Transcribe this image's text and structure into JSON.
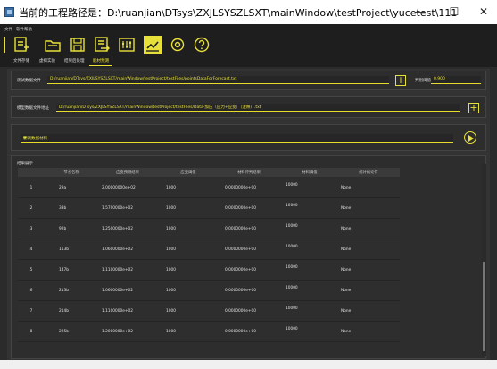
{
  "window": {
    "title": "当前的工程路径是：D:\\ruanjian\\DTsys\\ZXJLSYSZLSXT\\mainWindow\\testProject\\yucetest\\111",
    "minimize": "—",
    "maximize": "☐",
    "close": "✕"
  },
  "menu": {
    "items": [
      "文件",
      "软件帮助"
    ]
  },
  "toolbar": {
    "icons": [
      "new-file-icon",
      "open-folder-icon",
      "save-icon",
      "export-icon",
      "equalizer-icon",
      "chart-icon",
      "settings-icon",
      "help-icon"
    ]
  },
  "tabs": [
    "文件存储",
    "虚拟实验",
    "结果后处理",
    "能材预测"
  ],
  "active_tab": 3,
  "form": {
    "test_file_label": "测试数据文件",
    "test_file_value": "D:/ruanjian/DTsys/ZXJLSYSZLSXT/mainWindow/testProject/testFiles/pointsDataForForecast.txt",
    "threshold_label": "判别阈值",
    "threshold_value": "0.900",
    "model_file_label": "模型数据文件地址",
    "model_file_value": "D:/ruanjian/DTsys/ZXJLSYSZLSXT/mainWindow/testProject/testFiles/Data-加压（应力+应变）（注释）.txt",
    "test_type_value": "测试数据材料",
    "add_symbol": "+"
  },
  "results": {
    "section_label": "结果展示",
    "columns": [
      "节点名称",
      "应变预测结果",
      "应变阈值",
      "材料评判结果",
      "材料阈值",
      "统计结论符"
    ],
    "rows": [
      {
        "n": "1",
        "name": "29a",
        "strain": "2.00000000e+02",
        "strain_th": "1000",
        "mat": "0.0000000e+00",
        "mat_th": "10000",
        "concl": "None"
      },
      {
        "n": "2",
        "name": "33b",
        "strain": "1.5700000e+02",
        "strain_th": "1000",
        "mat": "0.0000000e+00",
        "mat_th": "10000",
        "concl": "None"
      },
      {
        "n": "3",
        "name": "92b",
        "strain": "1.2500000e+02",
        "strain_th": "1000",
        "mat": "0.0000000e+00",
        "mat_th": "10000",
        "concl": "None"
      },
      {
        "n": "4",
        "name": "113b",
        "strain": "1.0600000e+02",
        "strain_th": "1000",
        "mat": "0.0000000e+00",
        "mat_th": "10000",
        "concl": "None"
      },
      {
        "n": "5",
        "name": "147b",
        "strain": "1.1100000e+02",
        "strain_th": "1000",
        "mat": "0.0000000e+00",
        "mat_th": "10000",
        "concl": "None"
      },
      {
        "n": "6",
        "name": "213b",
        "strain": "1.0600000e+02",
        "strain_th": "1000",
        "mat": "0.0000000e+00",
        "mat_th": "10000",
        "concl": "None"
      },
      {
        "n": "7",
        "name": "214b",
        "strain": "1.1100000e+02",
        "strain_th": "1000",
        "mat": "0.0000000e+00",
        "mat_th": "10000",
        "concl": "None"
      },
      {
        "n": "8",
        "name": "225b",
        "strain": "1.2000000e+02",
        "strain_th": "1000",
        "mat": "0.0000000e+00",
        "mat_th": "10000",
        "concl": "None"
      }
    ]
  },
  "colors": {
    "accent": "#e8e03a",
    "background": "#2b2b2b",
    "panel": "#333333"
  }
}
